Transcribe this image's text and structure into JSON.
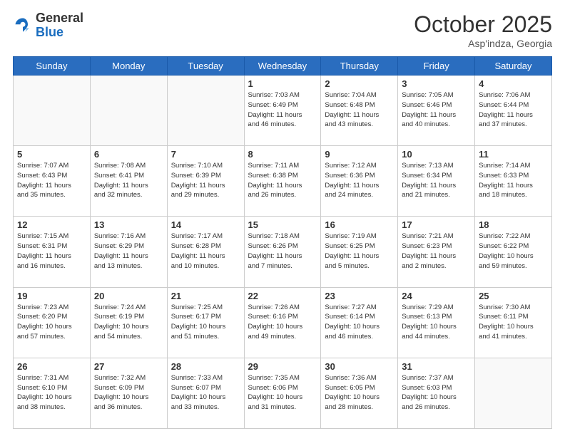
{
  "header": {
    "logo_general": "General",
    "logo_blue": "Blue",
    "month_title": "October 2025",
    "location": "Asp'indza, Georgia"
  },
  "days_of_week": [
    "Sunday",
    "Monday",
    "Tuesday",
    "Wednesday",
    "Thursday",
    "Friday",
    "Saturday"
  ],
  "weeks": [
    [
      {
        "day": "",
        "info": ""
      },
      {
        "day": "",
        "info": ""
      },
      {
        "day": "",
        "info": ""
      },
      {
        "day": "1",
        "info": "Sunrise: 7:03 AM\nSunset: 6:49 PM\nDaylight: 11 hours\nand 46 minutes."
      },
      {
        "day": "2",
        "info": "Sunrise: 7:04 AM\nSunset: 6:48 PM\nDaylight: 11 hours\nand 43 minutes."
      },
      {
        "day": "3",
        "info": "Sunrise: 7:05 AM\nSunset: 6:46 PM\nDaylight: 11 hours\nand 40 minutes."
      },
      {
        "day": "4",
        "info": "Sunrise: 7:06 AM\nSunset: 6:44 PM\nDaylight: 11 hours\nand 37 minutes."
      }
    ],
    [
      {
        "day": "5",
        "info": "Sunrise: 7:07 AM\nSunset: 6:43 PM\nDaylight: 11 hours\nand 35 minutes."
      },
      {
        "day": "6",
        "info": "Sunrise: 7:08 AM\nSunset: 6:41 PM\nDaylight: 11 hours\nand 32 minutes."
      },
      {
        "day": "7",
        "info": "Sunrise: 7:10 AM\nSunset: 6:39 PM\nDaylight: 11 hours\nand 29 minutes."
      },
      {
        "day": "8",
        "info": "Sunrise: 7:11 AM\nSunset: 6:38 PM\nDaylight: 11 hours\nand 26 minutes."
      },
      {
        "day": "9",
        "info": "Sunrise: 7:12 AM\nSunset: 6:36 PM\nDaylight: 11 hours\nand 24 minutes."
      },
      {
        "day": "10",
        "info": "Sunrise: 7:13 AM\nSunset: 6:34 PM\nDaylight: 11 hours\nand 21 minutes."
      },
      {
        "day": "11",
        "info": "Sunrise: 7:14 AM\nSunset: 6:33 PM\nDaylight: 11 hours\nand 18 minutes."
      }
    ],
    [
      {
        "day": "12",
        "info": "Sunrise: 7:15 AM\nSunset: 6:31 PM\nDaylight: 11 hours\nand 16 minutes."
      },
      {
        "day": "13",
        "info": "Sunrise: 7:16 AM\nSunset: 6:29 PM\nDaylight: 11 hours\nand 13 minutes."
      },
      {
        "day": "14",
        "info": "Sunrise: 7:17 AM\nSunset: 6:28 PM\nDaylight: 11 hours\nand 10 minutes."
      },
      {
        "day": "15",
        "info": "Sunrise: 7:18 AM\nSunset: 6:26 PM\nDaylight: 11 hours\nand 7 minutes."
      },
      {
        "day": "16",
        "info": "Sunrise: 7:19 AM\nSunset: 6:25 PM\nDaylight: 11 hours\nand 5 minutes."
      },
      {
        "day": "17",
        "info": "Sunrise: 7:21 AM\nSunset: 6:23 PM\nDaylight: 11 hours\nand 2 minutes."
      },
      {
        "day": "18",
        "info": "Sunrise: 7:22 AM\nSunset: 6:22 PM\nDaylight: 10 hours\nand 59 minutes."
      }
    ],
    [
      {
        "day": "19",
        "info": "Sunrise: 7:23 AM\nSunset: 6:20 PM\nDaylight: 10 hours\nand 57 minutes."
      },
      {
        "day": "20",
        "info": "Sunrise: 7:24 AM\nSunset: 6:19 PM\nDaylight: 10 hours\nand 54 minutes."
      },
      {
        "day": "21",
        "info": "Sunrise: 7:25 AM\nSunset: 6:17 PM\nDaylight: 10 hours\nand 51 minutes."
      },
      {
        "day": "22",
        "info": "Sunrise: 7:26 AM\nSunset: 6:16 PM\nDaylight: 10 hours\nand 49 minutes."
      },
      {
        "day": "23",
        "info": "Sunrise: 7:27 AM\nSunset: 6:14 PM\nDaylight: 10 hours\nand 46 minutes."
      },
      {
        "day": "24",
        "info": "Sunrise: 7:29 AM\nSunset: 6:13 PM\nDaylight: 10 hours\nand 44 minutes."
      },
      {
        "day": "25",
        "info": "Sunrise: 7:30 AM\nSunset: 6:11 PM\nDaylight: 10 hours\nand 41 minutes."
      }
    ],
    [
      {
        "day": "26",
        "info": "Sunrise: 7:31 AM\nSunset: 6:10 PM\nDaylight: 10 hours\nand 38 minutes."
      },
      {
        "day": "27",
        "info": "Sunrise: 7:32 AM\nSunset: 6:09 PM\nDaylight: 10 hours\nand 36 minutes."
      },
      {
        "day": "28",
        "info": "Sunrise: 7:33 AM\nSunset: 6:07 PM\nDaylight: 10 hours\nand 33 minutes."
      },
      {
        "day": "29",
        "info": "Sunrise: 7:35 AM\nSunset: 6:06 PM\nDaylight: 10 hours\nand 31 minutes."
      },
      {
        "day": "30",
        "info": "Sunrise: 7:36 AM\nSunset: 6:05 PM\nDaylight: 10 hours\nand 28 minutes."
      },
      {
        "day": "31",
        "info": "Sunrise: 7:37 AM\nSunset: 6:03 PM\nDaylight: 10 hours\nand 26 minutes."
      },
      {
        "day": "",
        "info": ""
      }
    ]
  ]
}
